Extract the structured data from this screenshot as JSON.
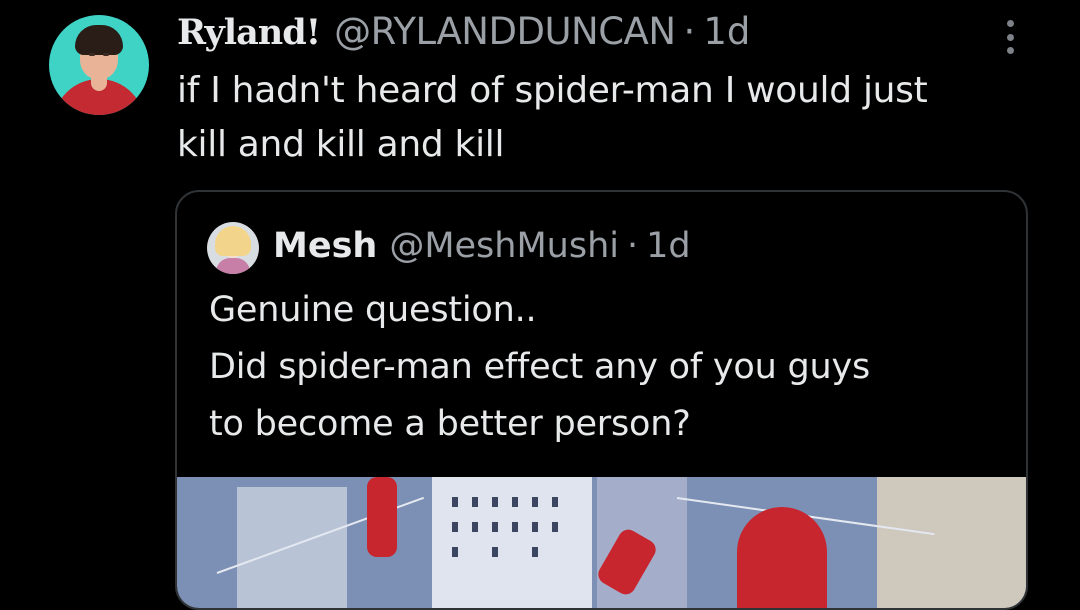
{
  "tweet": {
    "author": {
      "display_name": "Ryland!",
      "handle": "@RYLANDDUNCAN",
      "separator": "·",
      "time": "1d"
    },
    "text": "if I hadn't heard of spider-man I would just\nkill and kill and kill",
    "more_icon": "more-vertical-icon"
  },
  "quoted_tweet": {
    "author": {
      "display_name": "Mesh",
      "handle": "@MeshMushi",
      "separator": "·",
      "time": "1d"
    },
    "text": "Genuine question..\nDid spider-man effect any of you guys\nto become a better person?",
    "media": {
      "description": "spider-man-comic-art"
    }
  },
  "colors": {
    "background": "#000000",
    "text_primary": "#e7e9ea",
    "text_secondary": "#9aa0a6",
    "border": "#2f3336"
  }
}
